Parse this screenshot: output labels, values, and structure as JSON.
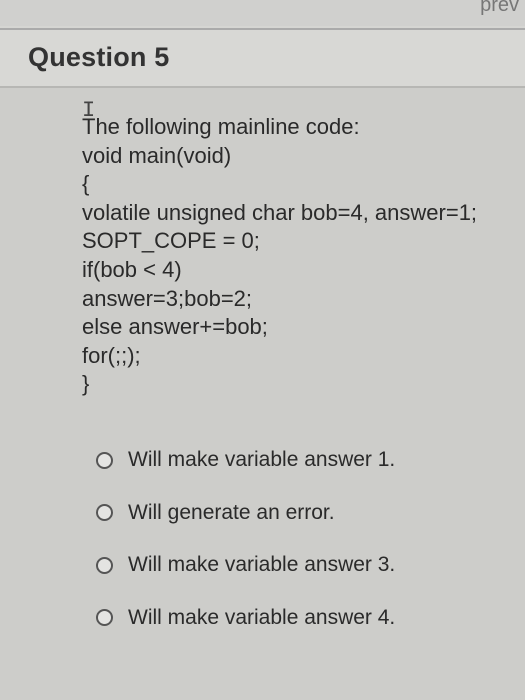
{
  "header": {
    "question_title": "Question 5",
    "corner_text": "prev"
  },
  "question": {
    "cursor_glyph": "I",
    "code_lines": [
      "The following mainline code:",
      "void main(void)",
      "{",
      "volatile unsigned char bob=4, answer=1;",
      "SOPT_COPE = 0;",
      "if(bob < 4)",
      "answer=3;bob=2;",
      "else answer+=bob;",
      "for(;;);",
      "}"
    ]
  },
  "options": [
    {
      "label": "Will make variable answer 1.",
      "selected": false
    },
    {
      "label": "Will generate an error.",
      "selected": false
    },
    {
      "label": "Will make variable answer 3.",
      "selected": false
    },
    {
      "label": "Will make variable answer 4.",
      "selected": false
    }
  ]
}
